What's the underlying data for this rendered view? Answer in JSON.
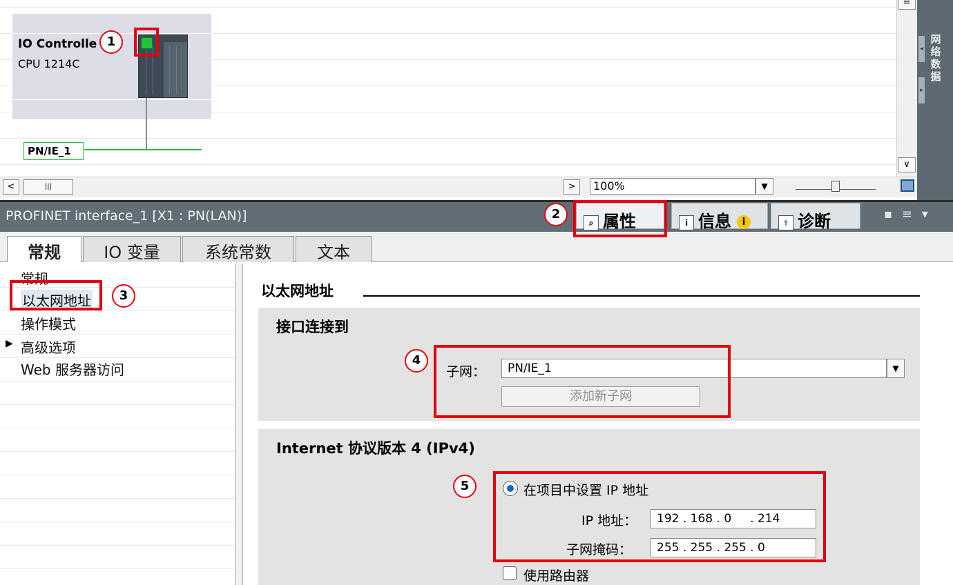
{
  "network_view": {
    "device_name": "IO Controlle",
    "device_type": "CPU 1214C",
    "network_label": "PN/IE_1",
    "zoom_value": "100%",
    "side_tab_label": "网络数据"
  },
  "inspector": {
    "title": "PROFINET interface_1 [X1 : PN(LAN)]",
    "tabs": [
      {
        "label": "属性"
      },
      {
        "label": "信息"
      },
      {
        "label": "诊断"
      }
    ]
  },
  "sub_tabs": [
    {
      "label": "常规"
    },
    {
      "label": "IO 变量"
    },
    {
      "label": "系统常数"
    },
    {
      "label": "文本"
    }
  ],
  "nav": {
    "items": [
      {
        "label": "常规"
      },
      {
        "label": "以太网地址"
      },
      {
        "label": "操作模式"
      },
      {
        "label": "高级选项"
      },
      {
        "label": "Web 服务器访问"
      }
    ]
  },
  "ethernet": {
    "section_title": "以太网地址",
    "interface_panel": {
      "title": "接口连接到",
      "subnet_label": "子网：",
      "subnet_value": "PN/IE_1",
      "add_subnet_button": "添加新子网"
    },
    "ipv4_panel": {
      "title": "Internet 协议版本 4 (IPv4)",
      "set_ip_option": "在项目中设置 IP 地址",
      "ip_label": "IP 地址：",
      "ip_value": "192 . 168 . 0     . 214",
      "mask_label": "子网掩码：",
      "mask_value": "255 . 255 . 255 . 0",
      "router_option": "使用路由器"
    }
  },
  "callouts": [
    "1",
    "2",
    "3",
    "4",
    "5"
  ],
  "colors": {
    "annotation_red": "#e3000f",
    "network_green": "#19c43a",
    "led_green": "#22c33a",
    "inspector_bar": "#626e75",
    "panel_gray": "#e3e3e3"
  }
}
